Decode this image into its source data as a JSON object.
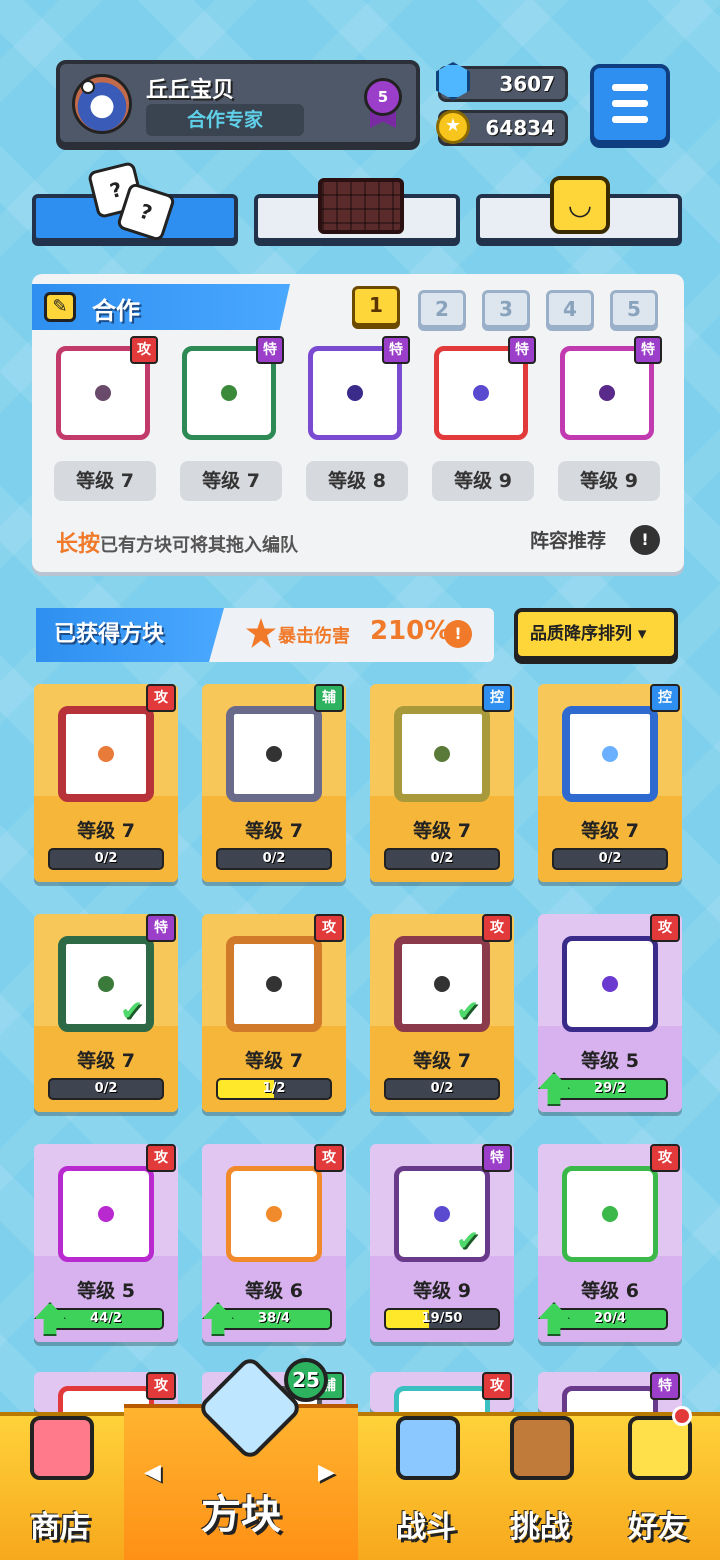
{
  "profile": {
    "name": "丘丘宝贝",
    "title": "合作专家",
    "rank": "5"
  },
  "currency": {
    "gems": "3607",
    "coins": "64834"
  },
  "mode_tabs": [
    {
      "icon": "dice-icon",
      "active": true
    },
    {
      "icon": "chocolate-block-icon",
      "active": false
    },
    {
      "icon": "smile-block-icon",
      "active": false
    }
  ],
  "deck": {
    "title": "合作",
    "pages": [
      "1",
      "2",
      "3",
      "4",
      "5"
    ],
    "active_page": "1",
    "slots": [
      {
        "tag": "攻",
        "tag_type": "atk",
        "level": "等级 7",
        "border": "#c23a6a",
        "dot": "#6a4a6a"
      },
      {
        "tag": "特",
        "tag_type": "spc",
        "level": "等级 7",
        "border": "#2e8a55",
        "dot": "#3a8a3a"
      },
      {
        "tag": "特",
        "tag_type": "spc",
        "level": "等级 8",
        "border": "#7a4ad0",
        "dot": "#3a2a8a"
      },
      {
        "tag": "特",
        "tag_type": "spc",
        "level": "等级 9",
        "border": "#e23a3a",
        "dot": "#5a4ad0"
      },
      {
        "tag": "特",
        "tag_type": "spc",
        "level": "等级 9",
        "border": "#c23ab0",
        "dot": "#5a2a8a"
      }
    ],
    "hint_em": "长按",
    "hint_rest": "已有方块可将其拖入编队",
    "recommend": "阵容推荐",
    "recommend_icon": "!"
  },
  "obtained": {
    "label": "已获得方块",
    "crit_label": "暴击伤害",
    "crit_value": "210%",
    "info_icon": "!",
    "sort_label": "品质降序排列 ▾"
  },
  "cards": [
    {
      "tag": "攻",
      "tag_type": "atk",
      "level": "等级 7",
      "progress": "0/2",
      "fill": 0,
      "fill_color": "#ffd63a",
      "bg": "orange",
      "border": "#b8323a",
      "dot": "#e87a3a",
      "arrow": false,
      "check": false
    },
    {
      "tag": "辅",
      "tag_type": "sup",
      "level": "等级 7",
      "progress": "0/2",
      "fill": 0,
      "fill_color": "#ffd63a",
      "bg": "orange",
      "border": "#6a6a8a",
      "dot": "#333",
      "arrow": false,
      "check": false
    },
    {
      "tag": "控",
      "tag_type": "ctl",
      "level": "等级 7",
      "progress": "0/2",
      "fill": 0,
      "fill_color": "#ffd63a",
      "bg": "orange",
      "border": "#a89a3a",
      "dot": "#5a7a3a",
      "arrow": false,
      "check": false
    },
    {
      "tag": "控",
      "tag_type": "ctl",
      "level": "等级 7",
      "progress": "0/2",
      "fill": 0,
      "fill_color": "#ffd63a",
      "bg": "orange",
      "border": "#2e6ad0",
      "dot": "#6ab0ff",
      "arrow": false,
      "check": false
    },
    {
      "tag": "特",
      "tag_type": "spc",
      "level": "等级 7",
      "progress": "0/2",
      "fill": 0,
      "fill_color": "#ffd63a",
      "bg": "orange",
      "border": "#2e6a45",
      "dot": "#3a7a3a",
      "arrow": false,
      "check": true
    },
    {
      "tag": "攻",
      "tag_type": "atk",
      "level": "等级 7",
      "progress": "1/2",
      "fill": 0.5,
      "fill_color": "#ffe82a",
      "bg": "orange",
      "border": "#d07a2a",
      "dot": "#333",
      "arrow": false,
      "check": false
    },
    {
      "tag": "攻",
      "tag_type": "atk",
      "level": "等级 7",
      "progress": "0/2",
      "fill": 0,
      "fill_color": "#ffd63a",
      "bg": "orange",
      "border": "#8a3a4a",
      "dot": "#333",
      "arrow": false,
      "check": true
    },
    {
      "tag": "攻",
      "tag_type": "atk",
      "level": "等级 5",
      "progress": "29/2",
      "fill": 1,
      "fill_color": "#3fd25a",
      "bg": "purple",
      "border": "#3a2a8a",
      "dot": "#6a3ad0",
      "arrow": true,
      "check": false
    },
    {
      "tag": "攻",
      "tag_type": "atk",
      "level": "等级 5",
      "progress": "44/2",
      "fill": 1,
      "fill_color": "#3fd25a",
      "bg": "purple",
      "border": "#b82ad0",
      "dot": "#b82ad0",
      "arrow": true,
      "check": false
    },
    {
      "tag": "攻",
      "tag_type": "atk",
      "level": "等级 6",
      "progress": "38/4",
      "fill": 1,
      "fill_color": "#3fd25a",
      "bg": "purple",
      "border": "#f08a2a",
      "dot": "#f08a2a",
      "arrow": true,
      "check": false
    },
    {
      "tag": "特",
      "tag_type": "spc",
      "level": "等级 9",
      "progress": "19/50",
      "fill": 0.38,
      "fill_color": "#ffe82a",
      "bg": "purple",
      "border": "#6a3a8a",
      "dot": "#5a4ad0",
      "arrow": false,
      "check": true
    },
    {
      "tag": "攻",
      "tag_type": "atk",
      "level": "等级 6",
      "progress": "20/4",
      "fill": 1,
      "fill_color": "#3fd25a",
      "bg": "purple",
      "border": "#3ab84a",
      "dot": "#3ab84a",
      "arrow": true,
      "check": false
    }
  ],
  "partial_row": [
    {
      "tag": "攻",
      "tag_type": "atk",
      "border": "#e23a3a"
    },
    {
      "tag": "辅",
      "tag_type": "sup",
      "border": "#555"
    },
    {
      "tag": "攻",
      "tag_type": "atk",
      "border": "#3ac0c0"
    },
    {
      "tag": "特",
      "tag_type": "spc",
      "border": "#6a3a8a"
    }
  ],
  "nav": {
    "shop": "商店",
    "blocks": "方块",
    "battle": "战斗",
    "challenge": "挑战",
    "friends": "好友",
    "blocks_badge": "25",
    "arrow_left": "◀",
    "arrow_right": "▶"
  }
}
